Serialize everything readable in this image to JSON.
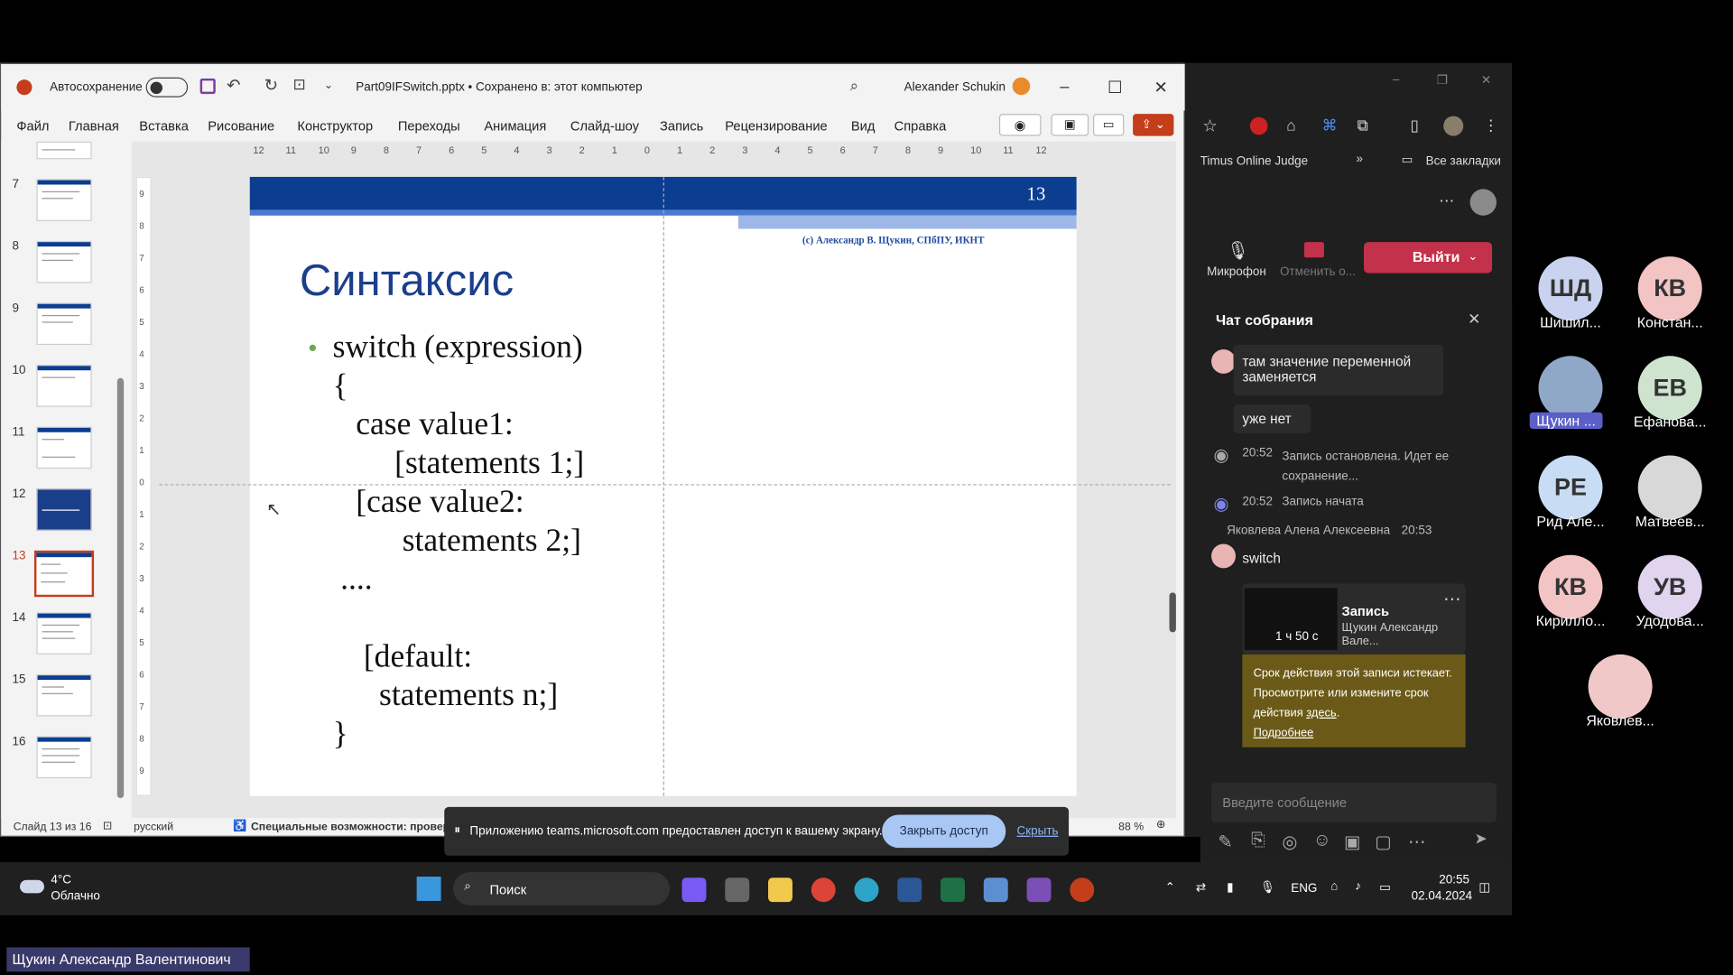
{
  "ppt": {
    "autosave_label": "Автосохранение",
    "file_title": "Part09IFSwitch.pptx • Сохранено в: этот компьютер",
    "user_name": "Alexander Schukin",
    "menu": [
      "Файл",
      "Главная",
      "Вставка",
      "Рисование",
      "Конструктор",
      "Переходы",
      "Анимация",
      "Слайд-шоу",
      "Запись",
      "Рецензирование",
      "Вид",
      "Справка"
    ],
    "ruler_numbers": [
      "12",
      "11",
      "10",
      "9",
      "8",
      "7",
      "6",
      "5",
      "4",
      "3",
      "2",
      "1",
      "0",
      "1",
      "2",
      "3",
      "4",
      "5",
      "6",
      "7",
      "8",
      "9",
      "10",
      "11",
      "12"
    ],
    "vruler_numbers": [
      "9",
      "8",
      "7",
      "6",
      "5",
      "4",
      "3",
      "2",
      "1",
      "0",
      "1",
      "2",
      "3",
      "4",
      "5",
      "6",
      "7",
      "8",
      "9"
    ],
    "thumb_numbers": [
      "7",
      "8",
      "9",
      "10",
      "11",
      "12",
      "13",
      "14",
      "15",
      "16"
    ],
    "slide": {
      "number": "13",
      "copyright": "(с) Александр В. Щукин, СПбПУ, ИКНТ",
      "title": "Синтаксис",
      "lines": [
        "switch (expression)",
        "{",
        "case value1:",
        "[statements 1;]",
        "[case value2:",
        "statements 2;]",
        "....",
        "[default:",
        "statements n;]",
        "}"
      ]
    },
    "status": {
      "slide_info": "Слайд 13 из 16",
      "language": "русский",
      "accessibility": "Специальные возможности: проверьт",
      "zoom": "88 %"
    }
  },
  "banner": {
    "text": "Приложению teams.microsoft.com предоставлен доступ к вашему экрану.",
    "stop_button": "Закрыть доступ",
    "hide_link": "Скрыть"
  },
  "browser": {
    "bookmark": "Timus Online Judge",
    "all_bookmarks": "Все закладки",
    "mic_label": "Микрофон",
    "cam_label": "Отменить о...",
    "leave_button": "Выйти",
    "chat_title": "Чат собрания",
    "messages": {
      "m1": "там значение переменной заменяется",
      "m2": "уже нет",
      "sys1_time": "20:52",
      "sys1_text": "Запись остановлена. Идет ее сохранение...",
      "sys2_time": "20:52",
      "sys2_text": "Запись начата",
      "sender": "Яковлева Алена Алексеевна",
      "sender_time": "20:53",
      "m3": "switch",
      "rec_title": "Запись",
      "rec_author": "Щукин Александр Вале...",
      "rec_duration": "1 ч 50 с",
      "expiry_text": "Срок действия этой записи истекает. Просмотрите или измените срок действия",
      "expiry_link": "здесь",
      "more_link": "Подробнее"
    },
    "input_placeholder": "Введите сообщение"
  },
  "participants": [
    {
      "initials": "ШД",
      "name": "Шишил...",
      "color": "#c9d3f0"
    },
    {
      "initials": "КВ",
      "name": "Констан...",
      "color": "#f3c4c4"
    },
    {
      "initials": "",
      "name": "Щукин ...",
      "color": "#8fa8c8"
    },
    {
      "initials": "ЕВ",
      "name": "Ефанова...",
      "color": "#cfe4cf"
    },
    {
      "initials": "РЕ",
      "name": "Рид Але...",
      "color": "#c8dcf4"
    },
    {
      "initials": "",
      "name": "Матвеев...",
      "color": "#d8d8d8"
    },
    {
      "initials": "КВ",
      "name": "Кирилло...",
      "color": "#f3c4c4"
    },
    {
      "initials": "УВ",
      "name": "Удодова...",
      "color": "#e0d4ee"
    },
    {
      "initials": "",
      "name": "Яковлев...",
      "color": "#f0c8c8"
    }
  ],
  "taskbar": {
    "temp": "4°C",
    "weather": "Облачно",
    "search": "Поиск",
    "lang": "ENG",
    "time": "20:55",
    "date": "02.04.2024"
  },
  "name_label": "Щукин Александр Валентинович"
}
